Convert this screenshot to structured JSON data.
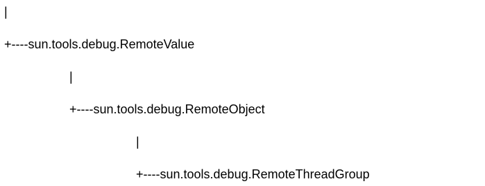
{
  "hierarchy": {
    "lines": [
      "|",
      "+----sun.tools.debug.RemoteValue",
      "|",
      "+----sun.tools.debug.RemoteObject",
      "|",
      "+----sun.tools.debug.RemoteThreadGroup"
    ]
  }
}
